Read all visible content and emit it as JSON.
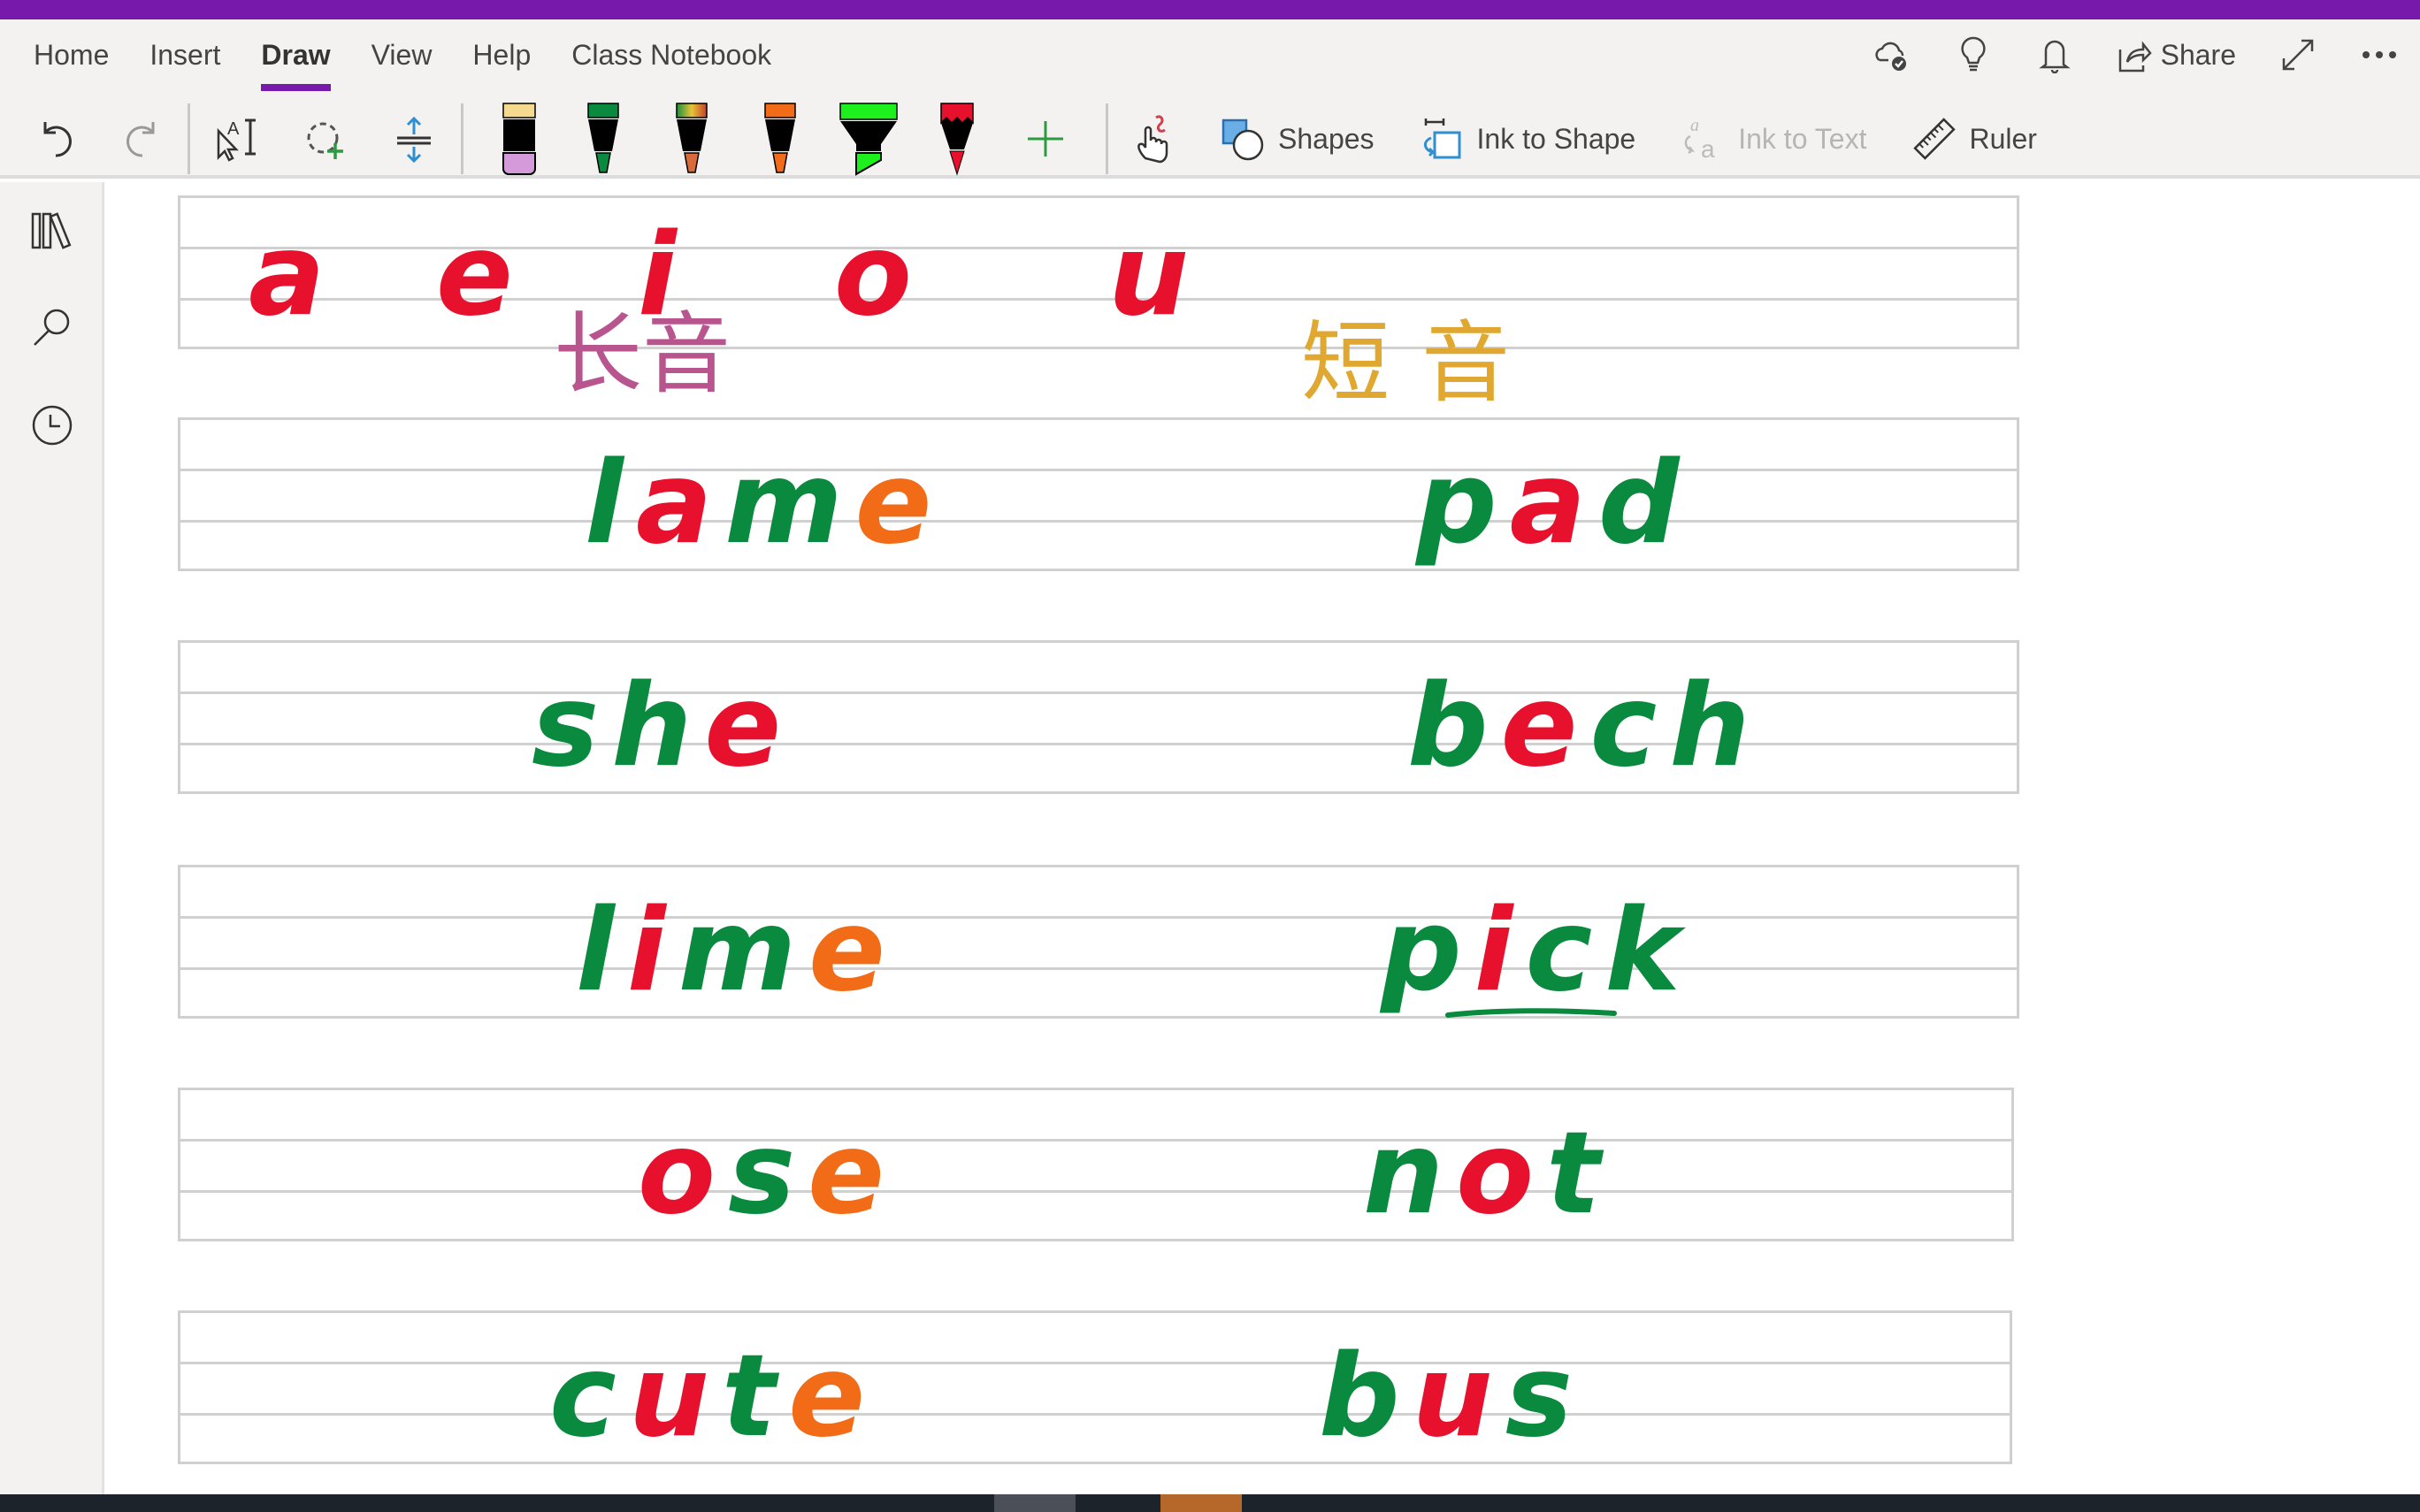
{
  "ribbon": {
    "tabs": [
      {
        "label": "Home",
        "active": false
      },
      {
        "label": "Insert",
        "active": false
      },
      {
        "label": "Draw",
        "active": true
      },
      {
        "label": "View",
        "active": false
      },
      {
        "label": "Help",
        "active": false
      },
      {
        "label": "Class Notebook",
        "active": false
      }
    ],
    "share_label": "Share",
    "right_icons": [
      "cloud-sync-icon",
      "lightbulb-icon",
      "bell-icon",
      "share-icon",
      "fullscreen-icon",
      "more-icon"
    ],
    "tools": {
      "undo": "undo-icon",
      "redo": "redo-icon",
      "type_select": "type-select-icon",
      "lasso": "lasso-select-icon",
      "add_space": "add-space-icon",
      "pens": [
        {
          "name": "eraser",
          "body": "#000000",
          "cap": "#f5d98f",
          "tip": "#d49ad9"
        },
        {
          "name": "green-pen",
          "cap": "#0a8a3e",
          "tip": "#0a8a3e"
        },
        {
          "name": "rainbow-pen",
          "cap": "#c87a28",
          "tip": "#d96a3a"
        },
        {
          "name": "orange-pen",
          "cap": "#f26b16",
          "tip": "#f26b16"
        },
        {
          "name": "green-highlighter",
          "cap": "#1ef01e",
          "tip": "#1ef01e"
        },
        {
          "name": "red-pencil",
          "cap": "#e8112d",
          "tip": "#e8112d"
        }
      ],
      "add_pen": "add-pen-icon",
      "touch_draw": "touch-draw-icon",
      "shapes_label": "Shapes",
      "ink_to_shape_label": "Ink to Shape",
      "ink_to_text_label": "Ink to Text",
      "ruler_label": "Ruler"
    }
  },
  "sidebar": [
    "notebooks-icon",
    "search-icon",
    "recent-icon"
  ],
  "colors": {
    "accent": "#7719aa",
    "ink_red": "#e8112d",
    "ink_green": "#0a8a3e",
    "ink_orange": "#f26b16"
  },
  "page": {
    "vowels": [
      "a",
      "e",
      "i",
      "o",
      "u"
    ],
    "long_vowel_label": "长音",
    "short_vowel_label": "短音",
    "rows": [
      {
        "long": [
          {
            "t": "l",
            "c": "green"
          },
          {
            "t": "a",
            "c": "red"
          },
          {
            "t": "m",
            "c": "green"
          },
          {
            "t": "e",
            "c": "orange"
          }
        ],
        "short": [
          {
            "t": "p",
            "c": "green"
          },
          {
            "t": "a",
            "c": "red"
          },
          {
            "t": "d",
            "c": "green"
          }
        ]
      },
      {
        "long": [
          {
            "t": "s",
            "c": "green"
          },
          {
            "t": "h",
            "c": "green"
          },
          {
            "t": "e",
            "c": "red"
          }
        ],
        "short": [
          {
            "t": "b",
            "c": "green"
          },
          {
            "t": "e",
            "c": "red"
          },
          {
            "t": "c",
            "c": "green"
          },
          {
            "t": "h",
            "c": "green"
          }
        ]
      },
      {
        "long": [
          {
            "t": "l",
            "c": "green"
          },
          {
            "t": "i",
            "c": "red"
          },
          {
            "t": "m",
            "c": "green"
          },
          {
            "t": "e",
            "c": "orange"
          }
        ],
        "short": [
          {
            "t": "p",
            "c": "green"
          },
          {
            "t": "i",
            "c": "red"
          },
          {
            "t": "c",
            "c": "green"
          },
          {
            "t": "k",
            "c": "green"
          }
        ]
      },
      {
        "long": [
          {
            "t": "o",
            "c": "red"
          },
          {
            "t": "s",
            "c": "green"
          },
          {
            "t": "e",
            "c": "orange"
          }
        ],
        "short": [
          {
            "t": "n",
            "c": "green"
          },
          {
            "t": "o",
            "c": "red"
          },
          {
            "t": "t",
            "c": "green"
          }
        ]
      },
      {
        "long": [
          {
            "t": "c",
            "c": "green"
          },
          {
            "t": "u",
            "c": "red"
          },
          {
            "t": "t",
            "c": "green"
          },
          {
            "t": "e",
            "c": "orange"
          }
        ],
        "short": [
          {
            "t": "b",
            "c": "green"
          },
          {
            "t": "u",
            "c": "red"
          },
          {
            "t": "s",
            "c": "green"
          }
        ]
      }
    ]
  }
}
